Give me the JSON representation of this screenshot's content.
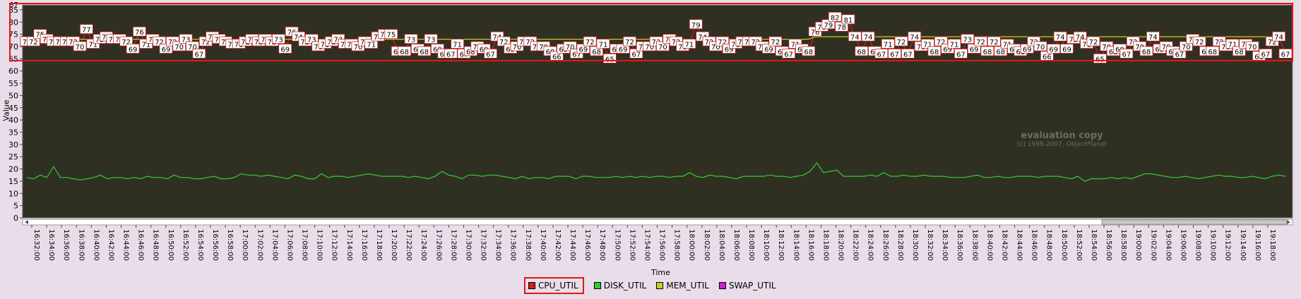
{
  "chart_data": {
    "type": "line",
    "xlabel": "Time",
    "ylabel": "Value",
    "ylim": [
      0,
      87
    ],
    "yticks": [
      0,
      5,
      10,
      15,
      20,
      25,
      30,
      35,
      40,
      45,
      50,
      55,
      60,
      65,
      70,
      75,
      80,
      85
    ],
    "top_tick_label": "87",
    "grid": false,
    "legend_position": "bottom-center",
    "time_range": [
      "16:32:00",
      "19:18:00"
    ],
    "x_tick_labels": [
      "16:32:00",
      "16:34:00",
      "16:36:00",
      "16:38:00",
      "16:40:00",
      "16:42:00",
      "16:44:00",
      "16:46:00",
      "16:48:00",
      "16:50:00",
      "16:52:00",
      "16:54:00",
      "16:56:00",
      "16:58:00",
      "17:00:00",
      "17:02:00",
      "17:04:00",
      "17:06:00",
      "17:08:00",
      "17:10:00",
      "17:12:00",
      "17:14:00",
      "17:16:00",
      "17:18:00",
      "17:20:00",
      "17:22:00",
      "17:24:00",
      "17:26:00",
      "17:28:00",
      "17:30:00",
      "17:32:00",
      "17:34:00",
      "17:36:00",
      "17:38:00",
      "17:40:00",
      "17:42:00",
      "17:44:00",
      "17:46:00",
      "17:48:00",
      "17:50:00",
      "17:52:00",
      "17:54:00",
      "17:56:00",
      "17:58:00",
      "18:00:00",
      "18:02:00",
      "18:04:00",
      "18:06:00",
      "18:08:00",
      "18:10:00",
      "18:12:00",
      "18:14:00",
      "18:16:00",
      "18:18:00",
      "18:20:00",
      "18:22:00",
      "18:24:00",
      "18:26:00",
      "18:28:00",
      "18:30:00",
      "18:32:00",
      "18:34:00",
      "18:36:00",
      "18:38:00",
      "18:40:00",
      "18:42:00",
      "18:44:00",
      "18:46:00",
      "18:48:00",
      "18:50:00",
      "18:52:00",
      "18:54:00",
      "18:56:00",
      "18:58:00",
      "19:00:00",
      "19:02:00",
      "19:04:00",
      "19:06:00",
      "19:08:00",
      "19:10:00",
      "19:12:00",
      "19:14:00",
      "19:16:00",
      "19:18:00"
    ],
    "series": [
      {
        "name": "CPU_UTIL",
        "color": "#cc2222",
        "values": [
          72,
          72,
          75,
          73,
          72,
          72,
          72,
          72,
          70,
          77,
          71,
          73,
          74,
          73,
          73,
          72,
          69,
          76,
          71,
          73,
          72,
          69,
          72,
          70,
          73,
          70,
          67,
          72,
          74,
          73,
          72,
          71,
          71,
          72,
          73,
          72,
          73,
          72,
          73,
          69,
          76,
          74,
          72,
          73,
          70,
          71,
          72,
          73,
          71,
          71,
          70,
          72,
          71,
          74,
          75,
          75,
          68,
          68,
          73,
          69,
          68,
          73,
          69,
          67,
          67,
          71,
          67,
          68,
          70,
          69,
          67,
          74,
          72,
          69,
          70,
          72,
          72,
          70,
          70,
          68,
          66,
          69,
          70,
          67,
          69,
          72,
          68,
          71,
          65,
          69,
          69,
          72,
          67,
          70,
          70,
          72,
          70,
          73,
          72,
          70,
          71,
          79,
          74,
          72,
          70,
          72,
          69,
          71,
          72,
          72,
          72,
          70,
          69,
          72,
          68,
          67,
          71,
          69,
          68,
          76,
          78,
          79,
          82,
          78,
          81,
          74,
          68,
          74,
          68,
          67,
          71,
          67,
          72,
          67,
          74,
          70,
          71,
          68,
          72,
          69,
          71,
          67,
          73,
          69,
          72,
          68,
          72,
          68,
          71,
          69,
          68,
          69,
          72,
          70,
          66,
          69,
          74,
          69,
          73,
          74,
          71,
          72,
          65,
          70,
          68,
          69,
          67,
          72,
          70,
          68,
          74,
          69,
          70,
          68,
          67,
          70,
          73,
          72,
          68,
          68,
          72,
          70,
          71,
          68,
          71,
          70,
          66,
          67,
          72,
          74,
          67
        ],
        "label_values": [
          72,
          72,
          75,
          73,
          72,
          72,
          72,
          72,
          70,
          77,
          71,
          73,
          74,
          73,
          73,
          72,
          69,
          76,
          71,
          73,
          72,
          69,
          72,
          70,
          73,
          70,
          67,
          72,
          74,
          73,
          72,
          71,
          71,
          72,
          73,
          72,
          73,
          72,
          73,
          69,
          76,
          74,
          72,
          73,
          70,
          71,
          72,
          73,
          71,
          71,
          70,
          72,
          71,
          74,
          75,
          75,
          68,
          68,
          73,
          69,
          68,
          73,
          69,
          67,
          67,
          71,
          67,
          68,
          70,
          69,
          67,
          74,
          72,
          69,
          70,
          72,
          72,
          70,
          70,
          68,
          66,
          69,
          70,
          67,
          69,
          72,
          68,
          71,
          65,
          69,
          69,
          72,
          67,
          70,
          70,
          72,
          70,
          73,
          72,
          70,
          71,
          79,
          74,
          72,
          70,
          72,
          69,
          71,
          72,
          72,
          72,
          70,
          69,
          72,
          68,
          67,
          71,
          69,
          68,
          76,
          78,
          79,
          82,
          78,
          81,
          74,
          68,
          74,
          68,
          67,
          71,
          67,
          72,
          67,
          74,
          70,
          71,
          68,
          72,
          69,
          71,
          67,
          73,
          69,
          72,
          68,
          72,
          68,
          71,
          69,
          68,
          69,
          72,
          70,
          66,
          69,
          74,
          69,
          73,
          74,
          71,
          72,
          65,
          70,
          68,
          69,
          67,
          72,
          70,
          68,
          74,
          69,
          70,
          68,
          67,
          70,
          73,
          72,
          68,
          68,
          72,
          70,
          71,
          68,
          71,
          70,
          66,
          67,
          72,
          74,
          67
        ]
      },
      {
        "name": "DISK_UTIL",
        "color": "#33cc33",
        "values": [
          16.5,
          16,
          17.5,
          16.5,
          21,
          16.5,
          16.5,
          16,
          15.5,
          16,
          16.5,
          17.5,
          16,
          16.5,
          16.5,
          16,
          16.5,
          16,
          17,
          16.5,
          16.5,
          16,
          17.5,
          16.5,
          16.5,
          16,
          16,
          16.5,
          17,
          16,
          16,
          16.5,
          18,
          17.5,
          17.5,
          17,
          17.5,
          17,
          16.5,
          16,
          17.5,
          17,
          16,
          16,
          18,
          16.5,
          17,
          17,
          16.5,
          17,
          17.5,
          18,
          17.5,
          17,
          17,
          17,
          17,
          16.5,
          17,
          16.5,
          16,
          17,
          19,
          17.5,
          17,
          16,
          17.5,
          17.5,
          17,
          17.5,
          17.5,
          17,
          16.5,
          16,
          17,
          16,
          16.5,
          16.5,
          16,
          17,
          17,
          17,
          16,
          17,
          17,
          16.5,
          16.5,
          16.5,
          17,
          16.5,
          17,
          16.5,
          17,
          16.5,
          17,
          17,
          16.5,
          17,
          17,
          18.5,
          17,
          16.5,
          17.5,
          17,
          17,
          16.5,
          16,
          17,
          17,
          17,
          17,
          17.5,
          17,
          17,
          16.5,
          17,
          17.5,
          19,
          22.5,
          18.5,
          19,
          19.5,
          17,
          17,
          17,
          17,
          17.5,
          17,
          18.5,
          17,
          17,
          17.5,
          17,
          17,
          17.5,
          17,
          17,
          17,
          16.5,
          16.5,
          16.5,
          17,
          17.5,
          16.5,
          16.5,
          17,
          16.5,
          16.5,
          17,
          17,
          17,
          16.5,
          17,
          17,
          17,
          16.5,
          16,
          17,
          15,
          16,
          16,
          16,
          16.5,
          16,
          16.5,
          16,
          17,
          18,
          18,
          17.5,
          17,
          16.5,
          16.5,
          17,
          16.5,
          16,
          16.5,
          17,
          17.5,
          17,
          17,
          16.5,
          16.5,
          17,
          16.5,
          16,
          17,
          17.5,
          17
        ]
      },
      {
        "name": "MEM_UTIL",
        "color": "#cccc22",
        "values": [
          73,
          73,
          73,
          73,
          73,
          73,
          73,
          73,
          73,
          73,
          73,
          73,
          73,
          73,
          73,
          73,
          73,
          73,
          73,
          73,
          73,
          73,
          73,
          73,
          73,
          73,
          73,
          73,
          73,
          73,
          73,
          73,
          73,
          73,
          73,
          73,
          73,
          73,
          73,
          73,
          73,
          73,
          73,
          73,
          73,
          73,
          73,
          73,
          73,
          73,
          73,
          73,
          73,
          73,
          73,
          73,
          73,
          73,
          73,
          73,
          73,
          73,
          73,
          73,
          73,
          73,
          73,
          73,
          73,
          73,
          73,
          73,
          73,
          73,
          73,
          73,
          73,
          73,
          73,
          73,
          73,
          73,
          73,
          73,
          73,
          73,
          73,
          73,
          73,
          73,
          73,
          73,
          73,
          73,
          73,
          73,
          73,
          73,
          73,
          73,
          73,
          73,
          73,
          73,
          73,
          73,
          73,
          73,
          73,
          73,
          73,
          73,
          73,
          73,
          73,
          73,
          73,
          73,
          73,
          74,
          74,
          74,
          74,
          74,
          74,
          74,
          74,
          74,
          74,
          74,
          74,
          74,
          74,
          74,
          74,
          74,
          74,
          74,
          74,
          74,
          74,
          74,
          74,
          74,
          74,
          74,
          74,
          74,
          74,
          74,
          74,
          74,
          74,
          74,
          74,
          74,
          74,
          74,
          74,
          74,
          74,
          74,
          74,
          74,
          74,
          74,
          74,
          74,
          74,
          74,
          74,
          74,
          74,
          74,
          74,
          74,
          74,
          74,
          74,
          74,
          74,
          74,
          74,
          74,
          74,
          74,
          74,
          74,
          74,
          74,
          74
        ]
      },
      {
        "name": "SWAP_UTIL",
        "color": "#cc22cc",
        "values": []
      }
    ]
  },
  "legend": {
    "items": [
      {
        "name": "CPU_UTIL",
        "color": "#cc2222"
      },
      {
        "name": "DISK_UTIL",
        "color": "#33cc33"
      },
      {
        "name": "MEM_UTIL",
        "color": "#cccc22"
      },
      {
        "name": "SWAP_UTIL",
        "color": "#cc22cc"
      }
    ]
  },
  "watermark": {
    "line1": "evaluation copy",
    "line2": "(c) 1998-2007, ObjectPlanet"
  },
  "colors": {
    "plot_bg": "#303022",
    "page_bg": "#e8dde8",
    "highlight": "#e01818"
  }
}
